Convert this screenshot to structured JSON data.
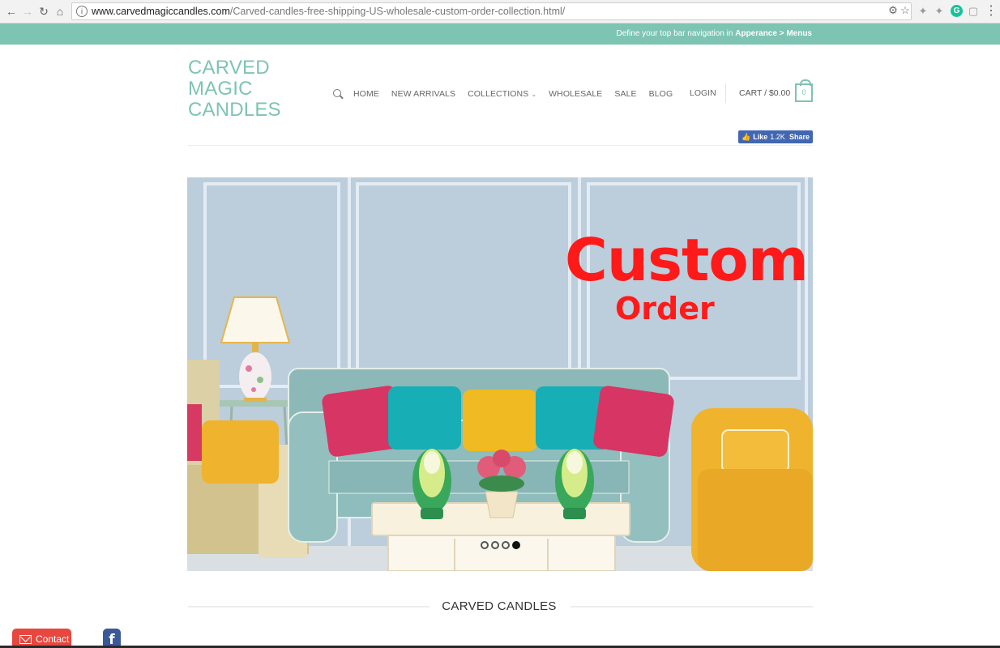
{
  "browser": {
    "url_host": "www.carvedmagiccandles.com",
    "url_path": "/Carved-candles-free-shipping-US-wholesale-custom-order-collection.html/",
    "icons": [
      "back-icon",
      "forward-icon",
      "reload-icon",
      "home-icon",
      "info-icon",
      "translate-icon",
      "star-icon",
      "extension-icon",
      "grammarly-icon",
      "menu-icon"
    ]
  },
  "topbar": {
    "text_prefix": "Define your top bar navigation in ",
    "text_link": "Apperance > Menus"
  },
  "logo": {
    "line1": "CARVED",
    "line2": "MAGIC",
    "line3": "CANDLES"
  },
  "nav": {
    "items": [
      {
        "label": "HOME"
      },
      {
        "label": "NEW ARRIVALS"
      },
      {
        "label": "COLLECTIONS"
      },
      {
        "label": "WHOLESALE"
      },
      {
        "label": "SALE"
      },
      {
        "label": "BLOG"
      }
    ],
    "login": "LOGIN",
    "cart": "CART / $0.00",
    "cart_count": "0"
  },
  "facebook": {
    "like_label": "Like",
    "like_count": "1.2K",
    "share_label": "Share"
  },
  "hero": {
    "title": "Custom",
    "subtitle": "Order",
    "slide_count": 4,
    "active_slide": 4
  },
  "section": {
    "title": "CARVED CANDLES"
  },
  "floating": {
    "contact_label": "Contact",
    "facebook_glyph": "f"
  },
  "colors": {
    "accent": "#7ec4b3",
    "hero_text": "#ff1a1a",
    "facebook": "#4267b2",
    "contact": "#e8473f"
  }
}
